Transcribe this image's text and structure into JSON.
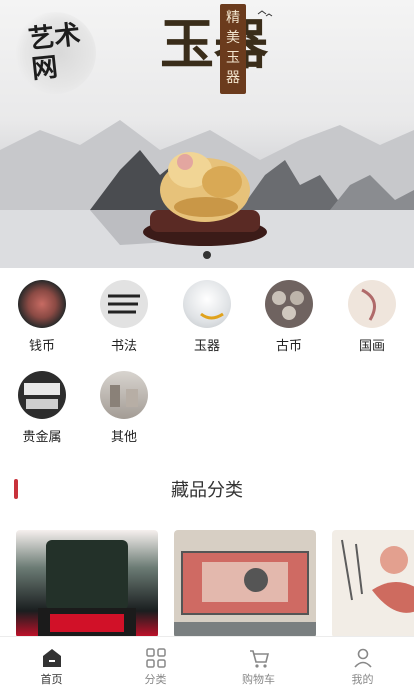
{
  "banner": {
    "logo_text": "艺术网",
    "seal_text": "精美玉器",
    "title_text": "玉器"
  },
  "categories": [
    {
      "label": "钱币",
      "icon": "banknotes"
    },
    {
      "label": "书法",
      "icon": "calligraphy"
    },
    {
      "label": "玉器",
      "icon": "jade"
    },
    {
      "label": "古币",
      "icon": "ancient-coins"
    },
    {
      "label": "国画",
      "icon": "chinese-painting"
    },
    {
      "label": "贵金属",
      "icon": "precious-metal"
    },
    {
      "label": "其他",
      "icon": "others"
    }
  ],
  "section": {
    "title": "藏品分类"
  },
  "tabs": [
    {
      "label": "首页",
      "icon": "home-icon",
      "active": true
    },
    {
      "label": "分类",
      "icon": "grid-icon",
      "active": false
    },
    {
      "label": "购物车",
      "icon": "cart-icon",
      "active": false
    },
    {
      "label": "我的",
      "icon": "user-icon",
      "active": false
    }
  ],
  "colors": {
    "accent": "#c8323b"
  }
}
